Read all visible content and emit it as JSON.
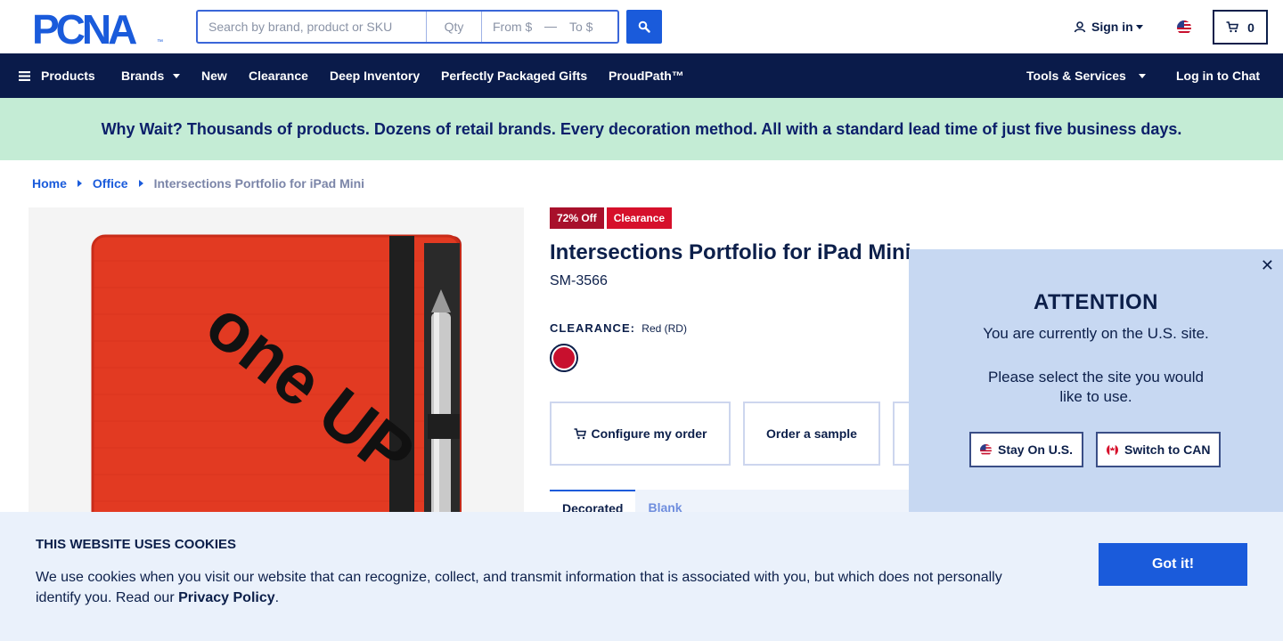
{
  "header": {
    "logo_text": "PCNA",
    "search": {
      "keyword_placeholder": "Search by brand, product or SKU",
      "qty_placeholder": "Qty",
      "from_placeholder": "From $",
      "to_placeholder": "To $"
    },
    "sign_in_label": "Sign in",
    "cart_count": "0"
  },
  "nav": {
    "items": [
      {
        "label": "Products"
      },
      {
        "label": "Brands"
      },
      {
        "label": "New"
      },
      {
        "label": "Clearance"
      },
      {
        "label": "Deep Inventory"
      },
      {
        "label": "Perfectly Packaged Gifts"
      },
      {
        "label": "ProudPath™"
      },
      {
        "label": "Tools & Services"
      },
      {
        "label": "Log in to Chat"
      }
    ]
  },
  "banner": {
    "text": "Why Wait? Thousands of products. Dozens of retail brands. Every decoration method. All with a standard lead time of just five business days."
  },
  "breadcrumb": {
    "items": [
      "Home",
      "Office"
    ],
    "current": "Intersections Portfolio for iPad Mini"
  },
  "product": {
    "badges": [
      {
        "label": "72% Off",
        "color": "#a8102b"
      },
      {
        "label": "Clearance",
        "color": "#d6102b"
      }
    ],
    "title": "Intersections Portfolio for iPad Mini",
    "sku": "SM-3566",
    "color_label": "CLEARANCE:",
    "color_value": "Red (RD)",
    "swatch_color": "#c8102e",
    "imprint_text": "one UP",
    "actions": {
      "configure": "Configure my order",
      "sample": "Order a sample"
    },
    "tabs": [
      {
        "label": "Decorated"
      },
      {
        "label": "Blank"
      }
    ]
  },
  "attention": {
    "heading": "ATTENTION",
    "line1": "You are currently on the U.S. site.",
    "line2": "Please select the site you would like to use.",
    "stay_label": "Stay On U.S.",
    "switch_label": "Switch to CAN"
  },
  "cookie": {
    "heading": "THIS WEBSITE USES COOKIES",
    "text": "We use cookies when you visit our website that can recognize, collect, and transmit information that is associated with you, but which does not personally identify you. Read our",
    "link": "Privacy Policy",
    "suffix": ".",
    "button": "Got it!"
  },
  "colors": {
    "navy": "#0a1b4a",
    "accent_blue": "#1a5bdb",
    "banner_green": "#c4ecd5",
    "attention_bg": "#c7d8f2",
    "cookie_bg": "#eaf1fb"
  }
}
